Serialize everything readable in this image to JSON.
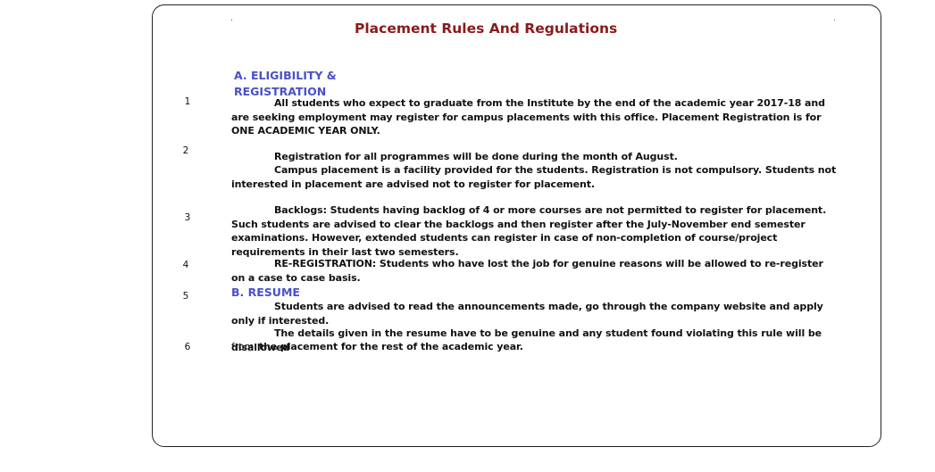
{
  "document": {
    "title": "Placement Rules And Regulations",
    "section_a": {
      "heading_line1": "A. ELIGIBILITY &",
      "heading_line2": "REGISTRATION"
    },
    "section_b": {
      "heading": "B. RESUME"
    },
    "numbers": [
      "1",
      "2",
      "3",
      "4",
      "5",
      "6"
    ],
    "rules": [
      "All students who expect to graduate from the Institute by the end of the academic year 2017-18 and are seeking employment may register for campus placements with this office. Placement Registration is for ONE ACADEMIC YEAR ONLY.",
      "Registration for all programmes will be done during the month of August.",
      "Campus placement is a facility provided for the students. Registration is not compulsory. Students not interested in placement are advised not to register for placement.",
      "Backlogs: Students having backlog of 4 or more courses are not permitted to register for placement. Such students are advised to clear the backlogs and then register after the July-November end semester examinations. However, extended students can register in case of non-completion of course/project requirements in their last two semesters.",
      "RE-REGISTRATION: Students who have lost the job for genuine reasons will be allowed to re-register on a case to case basis.",
      "Students are advised to read the announcements made, go through the company website and apply only if interested.",
      "The details given in the resume have to be genuine and any student found violating this rule will be disallowed",
      "from",
      "the placement for the rest of the academic year."
    ]
  }
}
